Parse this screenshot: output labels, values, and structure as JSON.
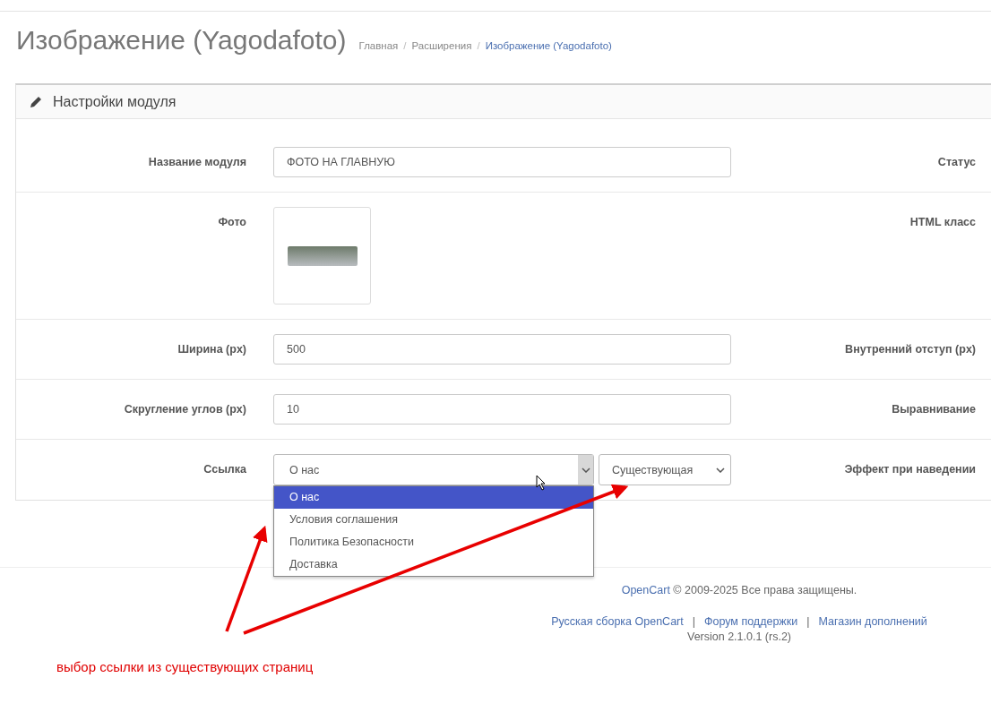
{
  "page_title": "Изображение (Yagodafoto)",
  "breadcrumb_separator": "/",
  "breadcrumbs": [
    {
      "label": "Главная",
      "current": false
    },
    {
      "label": "Расширения",
      "current": false
    },
    {
      "label": "Изображение (Yagodafoto)",
      "current": true
    }
  ],
  "panel": {
    "title": "Настройки модуля"
  },
  "rows": [
    {
      "kind": "text",
      "label": "Название модуля",
      "value": "ФОТО НА ГЛАВНУЮ",
      "side_label": "Статус"
    },
    {
      "kind": "image",
      "label": "Фото",
      "side_label": "HTML класс"
    },
    {
      "kind": "text",
      "label": "Ширина (px)",
      "value": "500",
      "side_label": "Внутренний отступ (px)"
    },
    {
      "kind": "text",
      "label": "Скругление углов (px)",
      "value": "10",
      "side_label": "Выравнивание"
    },
    {
      "kind": "select",
      "label": "Ссылка",
      "value": "О нас",
      "type_value": "Существующая",
      "side_label": "Эффект при наведении",
      "expanded": true,
      "options": [
        {
          "label": "О нас",
          "selected": true
        },
        {
          "label": "Условия соглашения",
          "selected": false
        },
        {
          "label": "Политика Безопасности",
          "selected": false
        },
        {
          "label": "Доставка",
          "selected": false
        }
      ]
    }
  ],
  "footer": {
    "brand_link": "OpenCart",
    "copyright": "© 2009-2025 Все права защищены.",
    "links": [
      "Русская сборка OpenCart",
      "Форум поддержки",
      "Магазин дополнений"
    ],
    "separator": "|",
    "version": "Version 2.1.0.1 (rs.2)"
  },
  "annotation": {
    "text": "выбор ссылки из существующих страниц"
  }
}
